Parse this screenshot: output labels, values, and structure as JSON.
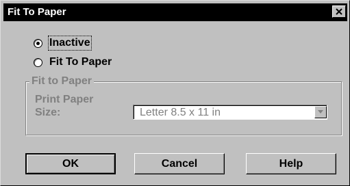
{
  "window": {
    "title": "Fit To Paper"
  },
  "mode": {
    "options": [
      {
        "label": "Inactive",
        "selected": true
      },
      {
        "label": "Fit To Paper",
        "selected": false
      }
    ]
  },
  "group": {
    "legend": "Fit to Paper",
    "size_label_line1": "Print Paper",
    "size_label_line2": "Size:",
    "size_value": "Letter 8.5 x 11 in",
    "disabled": true
  },
  "buttons": {
    "ok_label": "OK",
    "cancel_label": "Cancel",
    "help_label": "Help"
  },
  "colors": {
    "titlebar": "#000000",
    "face": "#c0c0c0",
    "disabled_text": "#808080"
  },
  "icons": {
    "close": "close-icon",
    "dropdown": "chevron-down-icon"
  }
}
